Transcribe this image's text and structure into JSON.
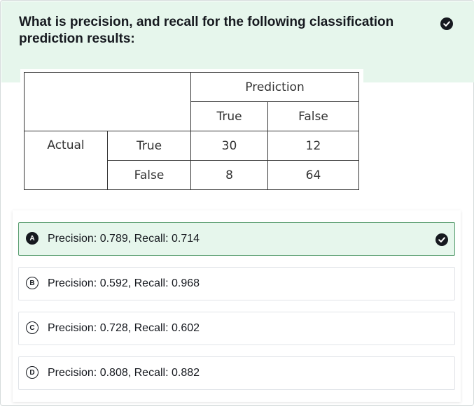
{
  "question": {
    "text": "What is precision, and recall for the following classification prediction results:",
    "status_icon": "check-circle-icon",
    "answered_correctly": true
  },
  "matrix": {
    "prediction_header": "Prediction",
    "predicted_labels": [
      "True",
      "False"
    ],
    "actual_header": "Actual",
    "actual_labels": [
      "True",
      "False"
    ],
    "cells": [
      [
        "30",
        "12"
      ],
      [
        "8",
        "64"
      ]
    ]
  },
  "options": [
    {
      "letter": "A",
      "text": "Precision: 0.789, Recall: 0.714",
      "selected": true,
      "correct": true
    },
    {
      "letter": "B",
      "text": "Precision: 0.592, Recall: 0.968",
      "selected": false
    },
    {
      "letter": "C",
      "text": "Precision: 0.728, Recall: 0.602",
      "selected": false
    },
    {
      "letter": "D",
      "text": "Precision: 0.808, Recall: 0.882",
      "selected": false
    }
  ],
  "colors": {
    "correct_background": "#e6f6ec",
    "correct_border": "#5a9e71",
    "text": "#16191f",
    "table_border": "#333333"
  }
}
